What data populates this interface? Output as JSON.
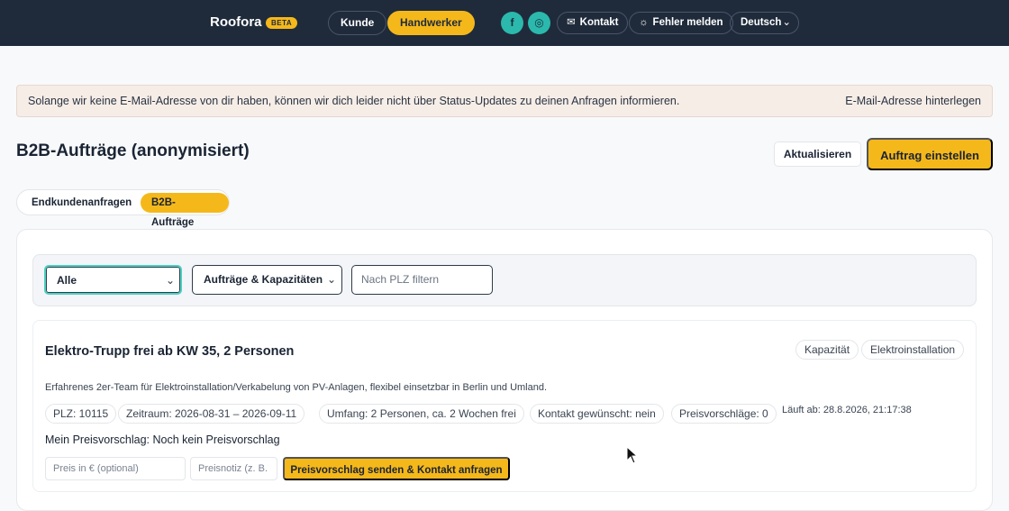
{
  "topbar": {
    "brand": "Roofora",
    "badge": "BETA",
    "nav": [
      {
        "label": "Kunde"
      },
      {
        "label": "Handwerker"
      }
    ],
    "social": [
      {
        "glyph": "f"
      },
      {
        "glyph": "◎"
      }
    ],
    "contact_label": "Kontakt",
    "report_label": "Fehler melden",
    "language": "Deutsch"
  },
  "notice": {
    "message": "Solange wir keine E-Mail-Adresse von dir haben, können wir dich leider nicht über Status-Updates zu deinen Anfragen informieren.",
    "link": "E-Mail-Adresse hinterlegen"
  },
  "page": {
    "title": "B2B-Aufträge (anonymisiert)",
    "refresh_label": "Aktualisieren",
    "create_label": "Auftrag einstellen"
  },
  "tabs": [
    {
      "label": "Endkundenanfragen"
    },
    {
      "label": "B2B-Aufträge"
    }
  ],
  "filters": {
    "status": "Alle",
    "type": "Aufträge & Kapazitäten",
    "plz_placeholder": "Nach PLZ filtern"
  },
  "card": {
    "title": "Elektro-Trupp frei ab KW 35, 2 Personen",
    "tags": [
      "Kapazität",
      "Elektroinstallation"
    ],
    "description": "Erfahrenes 2er-Team für Elektroinstallation/Verkabelung von PV-Anlagen, flexibel einsetzbar in Berlin und Umland.",
    "chips": [
      "PLZ: 10115",
      "Zeitraum: 2026-08-31 – 2026-09-11",
      "Umfang: 2 Personen, ca. 2 Wochen frei",
      "Kontakt gewünscht: nein",
      "Preisvorschläge: 0"
    ],
    "runs_from": "Läuft ab: 28.8.2026, 21:17:38",
    "my_offer": "Mein Preisvorschlag: Noch kein Preisvorschlag",
    "price_placeholder": "Preis in € (optional)",
    "note_placeholder": "Preisnotiz (z. B.",
    "send_label": "Preisvorschlag senden & Kontakt anfragen"
  }
}
